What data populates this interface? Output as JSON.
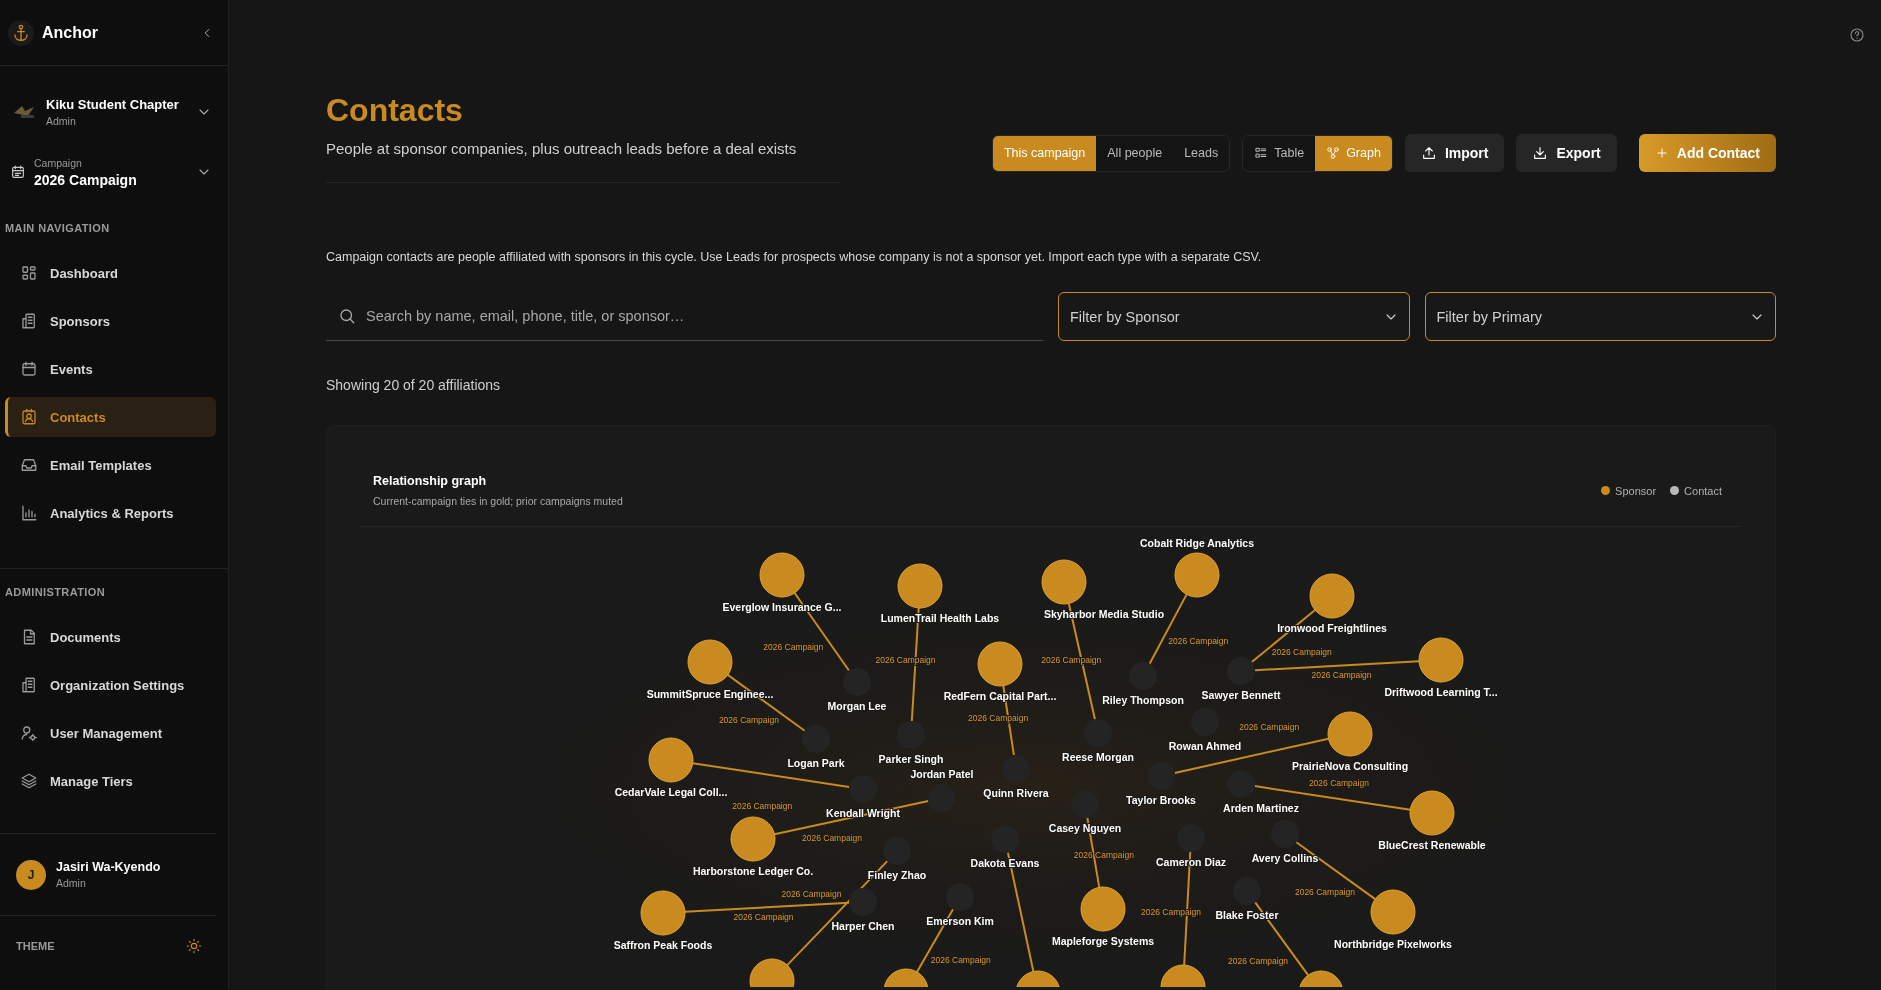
{
  "sidebar": {
    "brand": "Anchor",
    "organization": {
      "name": "Kiku Student Chapter",
      "role": "Admin"
    },
    "campaign": {
      "caption": "Campaign",
      "name": "2026 Campaign"
    },
    "sections": [
      {
        "heading": "MAIN NAVIGATION",
        "items": [
          {
            "label": "Dashboard",
            "selected": false
          },
          {
            "label": "Sponsors",
            "selected": false
          },
          {
            "label": "Events",
            "selected": false
          },
          {
            "label": "Contacts",
            "selected": true
          },
          {
            "label": "Email Templates",
            "selected": false
          },
          {
            "label": "Analytics & Reports",
            "selected": false
          }
        ]
      },
      {
        "heading": "ADMINISTRATION",
        "items": [
          {
            "label": "Documents",
            "selected": false
          },
          {
            "label": "Organization Settings",
            "selected": false
          },
          {
            "label": "User Management",
            "selected": false
          },
          {
            "label": "Manage Tiers",
            "selected": false
          }
        ]
      }
    ],
    "user": {
      "initial": "J",
      "name": "Jasiri Wa-Kyendo",
      "role": "Admin"
    },
    "theme_label": "THEME"
  },
  "header": {
    "title": "Contacts",
    "subtitle": "People at sponsor companies, plus outreach leads before a deal exists",
    "scope_tabs": [
      {
        "label": "This campaign",
        "selected": true
      },
      {
        "label": "All people",
        "selected": false
      },
      {
        "label": "Leads",
        "selected": false
      }
    ],
    "view_tabs": [
      {
        "label": "Table",
        "selected": false
      },
      {
        "label": "Graph",
        "selected": true
      }
    ],
    "buttons": [
      {
        "label": "Import",
        "kind": "default"
      },
      {
        "label": "Export",
        "kind": "default"
      },
      {
        "label": "Add Contact",
        "kind": "primary"
      }
    ]
  },
  "info": "Campaign contacts are people affiliated with sponsors in this cycle. Use Leads for prospects whose company is not a sponsor yet. Import each type with a separate CSV.",
  "search": {
    "placeholder": "Search by name, email, phone, title, or sponsor…"
  },
  "filters": [
    {
      "label": "Filter by Sponsor"
    },
    {
      "label": "Filter by Primary"
    }
  ],
  "count": "Showing 20 of 20 affiliations",
  "graph": {
    "title": "Relationship graph",
    "subtitle": "Current-campaign ties in gold; prior campaigns muted",
    "legend": [
      {
        "label": "Sponsor",
        "color": "#c98a1f"
      },
      {
        "label": "Contact",
        "color": "#b8b8b8"
      }
    ],
    "sponsors": [
      {
        "name": "Everglow Insurance G...",
        "tie": {
          "label": "2026 Campaign",
          "current": true
        }
      },
      {
        "name": "LumenTrail Health Labs",
        "tie": {
          "label": "2026 Campaign",
          "current": true
        }
      },
      {
        "name": "Skyharbor Media Studio",
        "tie": {
          "label": "2026 Campaign",
          "current": true
        }
      },
      {
        "name": "Cobalt Ridge Analytics",
        "tie": {
          "label": "2026 Campaign",
          "current": true
        }
      },
      {
        "name": "Ironwood Freightlines",
        "tie": {
          "label": "2026 Campaign",
          "current": true
        }
      },
      {
        "name": "SummitSpruce Enginee...",
        "tie": {
          "label": "2026 Campaign",
          "current": true
        }
      },
      {
        "name": "RedFern Capital Part...",
        "tie": {
          "label": "2026 Campaign",
          "current": true
        }
      },
      {
        "name": "Driftwood Learning T...",
        "tie": {
          "label": "2026 Campaign",
          "current": true
        }
      },
      {
        "name": "CedarVale Legal Coll...",
        "tie": {
          "label": "2026 Campaign",
          "current": true
        }
      },
      {
        "name": "PrairieNova Consulting",
        "tie": {
          "label": "2026 Campaign",
          "current": true
        }
      },
      {
        "name": "Harborstone Ledger Co.",
        "tie": {
          "label": "2026 Campaign",
          "current": true
        }
      },
      {
        "name": "BlueCrest Renewable",
        "tie": {
          "label": "2026 Campaign",
          "current": true
        }
      },
      {
        "name": "Saffron Peak Foods",
        "tie": {
          "label": "2026 Campaign",
          "current": true
        }
      },
      {
        "name": "Mapleforge Systems",
        "tie": {
          "label": "2026 Campaign",
          "current": true
        }
      },
      {
        "name": "Northbridge Pixelworks",
        "tie": {
          "label": "2026 Campaign",
          "current": true
        }
      }
    ],
    "cut_off_sponsors": [
      {
        "tie": {
          "label": "2026 Campaign",
          "current": true
        }
      },
      {
        "tie": {
          "label": "2026 Campaign",
          "current": true
        }
      },
      {
        "tie": {
          "current": true
        }
      },
      {
        "tie": {
          "label": "2026 Campaign",
          "current": true
        }
      },
      {
        "tie": {
          "label": "2026 Campaign",
          "current": true
        }
      }
    ],
    "contacts": [
      {
        "name": "Morgan Lee"
      },
      {
        "name": "Riley Thompson"
      },
      {
        "name": "Sawyer Bennett"
      },
      {
        "name": "Logan Park"
      },
      {
        "name": "Parker Singh"
      },
      {
        "name": "Reese Morgan"
      },
      {
        "name": "Rowan Ahmed"
      },
      {
        "name": "Kendall Wright"
      },
      {
        "name": "Jordan Patel"
      },
      {
        "name": "Quinn Rivera"
      },
      {
        "name": "Casey Nguyen"
      },
      {
        "name": "Taylor Brooks"
      },
      {
        "name": "Arden Martinez"
      },
      {
        "name": "Finley Zhao"
      },
      {
        "name": "Dakota Evans"
      },
      {
        "name": "Cameron Diaz"
      },
      {
        "name": "Avery Collins"
      },
      {
        "name": "Harper Chen"
      },
      {
        "name": "Emerson Kim"
      },
      {
        "name": "Blake Foster"
      }
    ]
  }
}
